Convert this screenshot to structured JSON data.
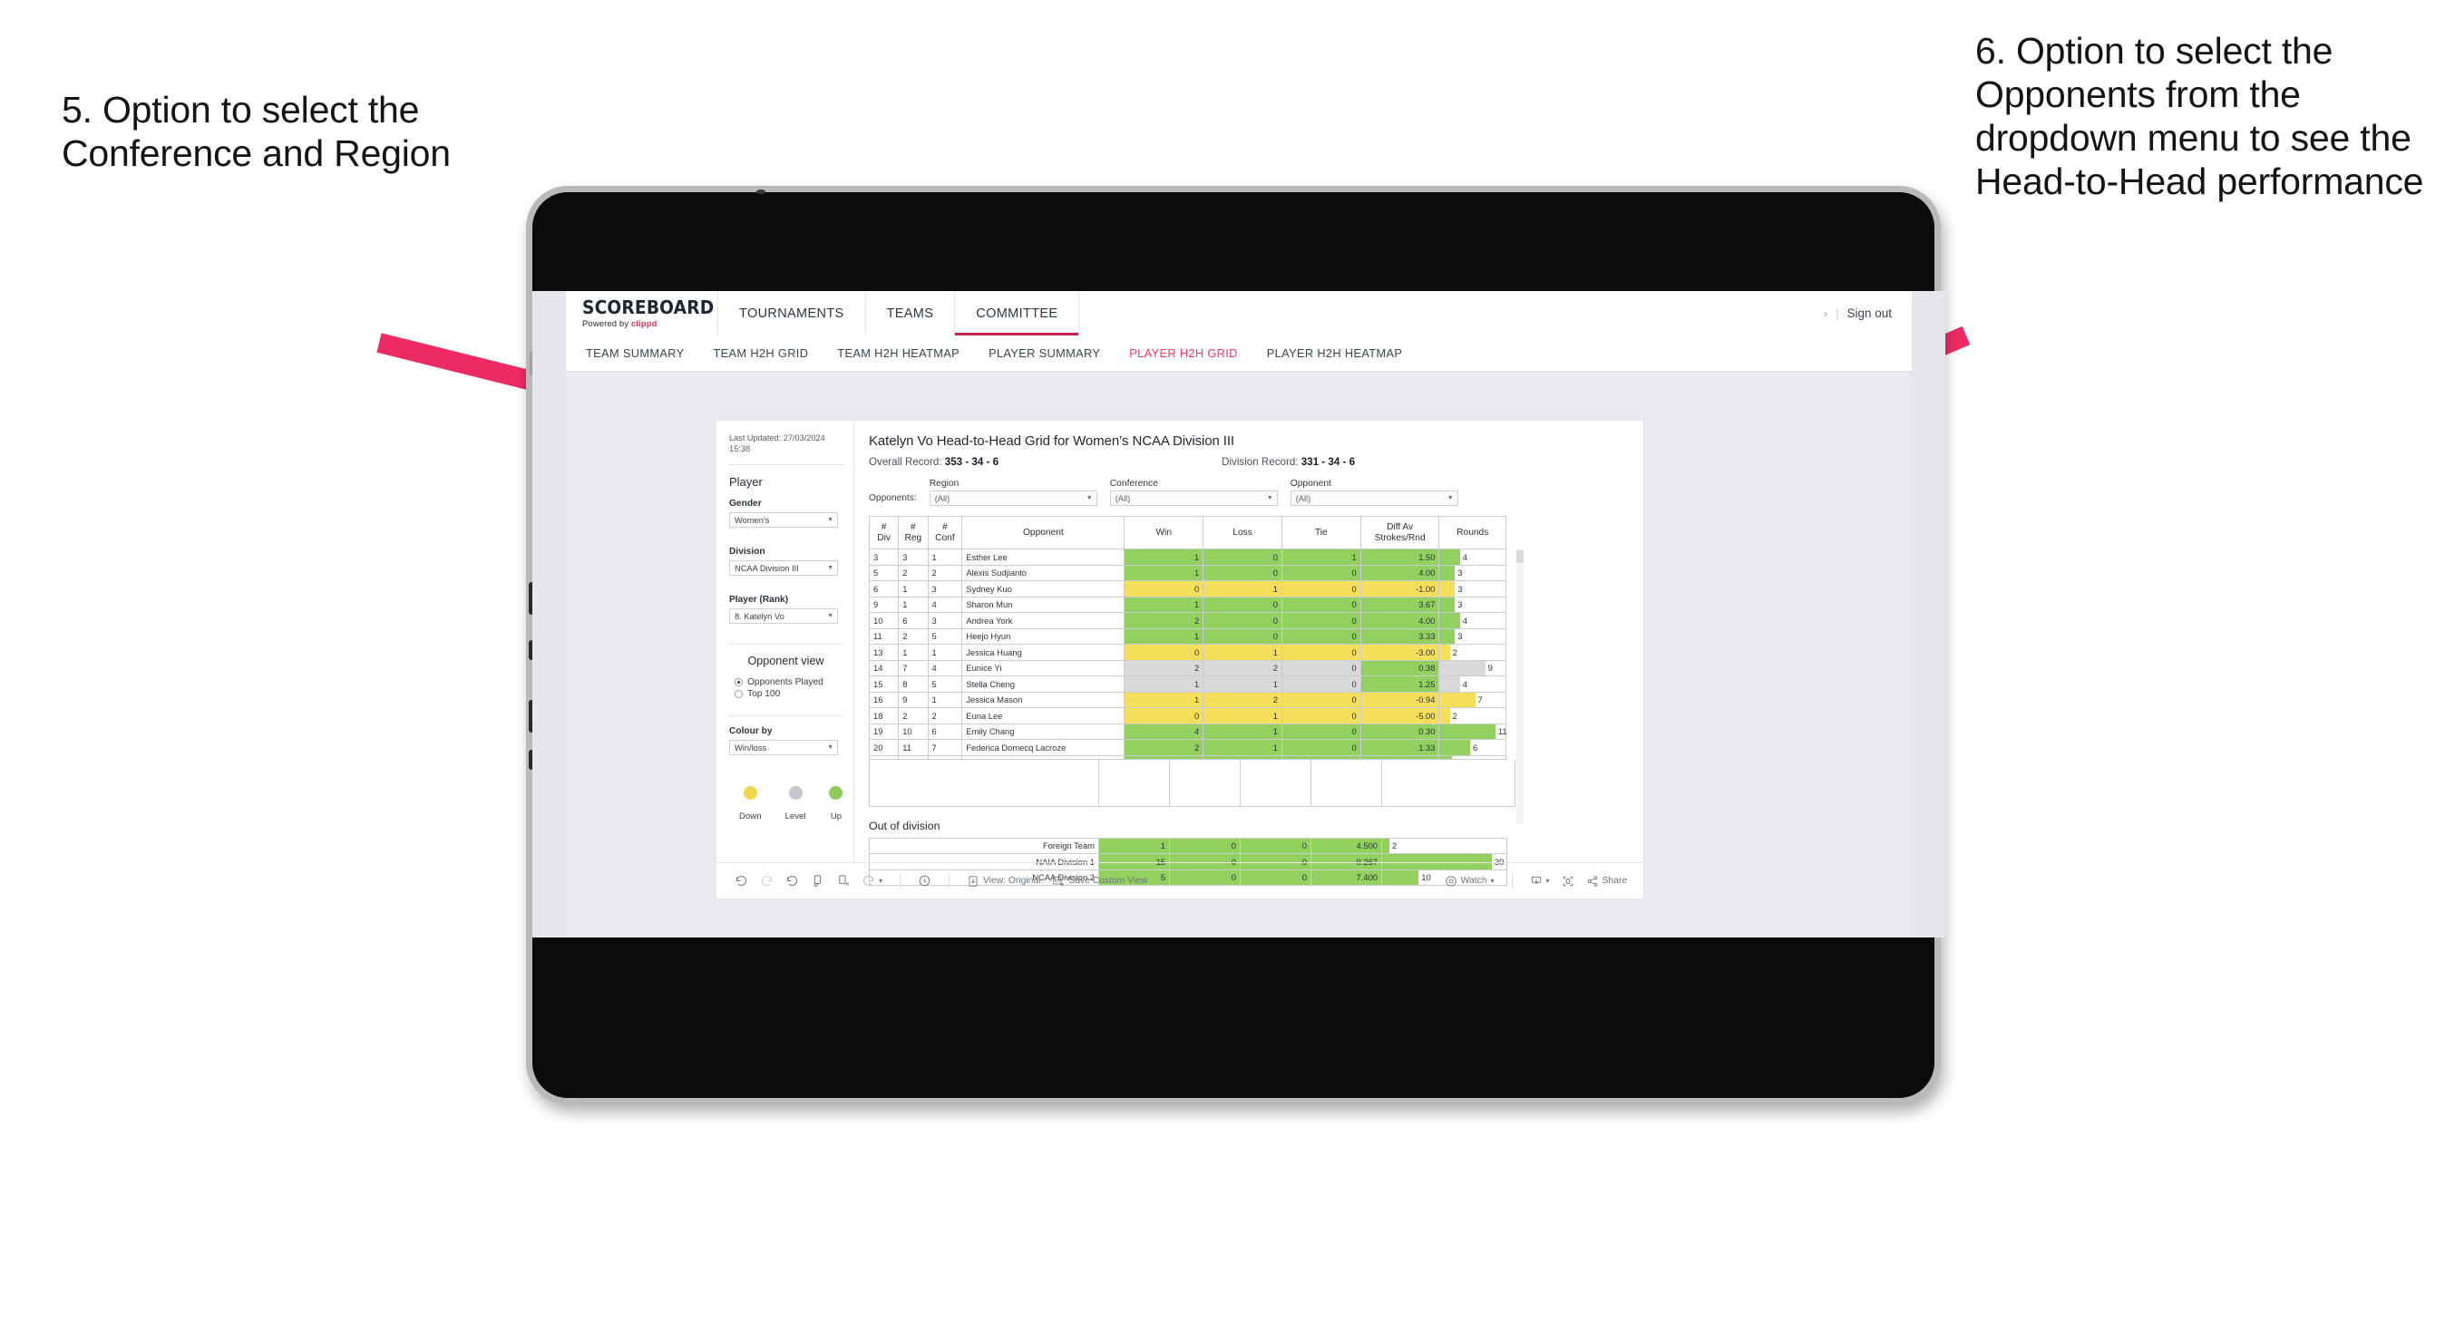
{
  "annotations": {
    "left": "5. Option to select the Conference and Region",
    "right": "6. Option to select the Opponents from the dropdown menu to see the Head-to-Head performance",
    "arrow_color": "#ec2a63"
  },
  "app": {
    "logo_main": "SCOREBOARD",
    "logo_sub_prefix": "Powered by ",
    "logo_sub_brand": "clippd",
    "top_nav": [
      {
        "label": "TOURNAMENTS",
        "active": false
      },
      {
        "label": "TEAMS",
        "active": false
      },
      {
        "label": "COMMITTEE",
        "active": true
      }
    ],
    "sign_out": "Sign out",
    "sign_out_chevron": "›",
    "sign_out_divider": "|",
    "sub_nav": [
      {
        "label": "TEAM SUMMARY",
        "active": false
      },
      {
        "label": "TEAM H2H GRID",
        "active": false
      },
      {
        "label": "TEAM H2H HEATMAP",
        "active": false
      },
      {
        "label": "PLAYER SUMMARY",
        "active": false
      },
      {
        "label": "PLAYER H2H GRID",
        "active": true
      },
      {
        "label": "PLAYER H2H HEATMAP",
        "active": false
      }
    ],
    "accent_color": "#ef3b63"
  },
  "sidebar": {
    "last_updated": "Last Updated: 27/03/2024 15:38",
    "player_heading": "Player",
    "gender_label": "Gender",
    "gender_value": "Women’s",
    "division_label": "Division",
    "division_value": "NCAA Division III",
    "player_rank_label": "Player (Rank)",
    "player_rank_value": "8. Katelyn Vo",
    "opponent_view_heading": "Opponent view",
    "opponent_view_options": [
      {
        "label": "Opponents Played",
        "selected": true
      },
      {
        "label": "Top 100",
        "selected": false
      }
    ],
    "colour_by_label": "Colour by",
    "colour_by_value": "Win/loss",
    "legend": [
      {
        "label": "Down",
        "color": "#f2d64b"
      },
      {
        "label": "Level",
        "color": "#c4c8cc"
      },
      {
        "label": "Up",
        "color": "#8ccb5c"
      }
    ]
  },
  "viz": {
    "title": "Katelyn Vo Head-to-Head Grid for Women’s NCAA Division III",
    "overall_record_label": "Overall Record:",
    "overall_record_value": "353 - 34 - 6",
    "division_record_label": "Division Record:",
    "division_record_value": "331 - 34 - 6",
    "opponents_label": "Opponents:",
    "filters": [
      {
        "title": "Region",
        "value": "(All)"
      },
      {
        "title": "Conference",
        "value": "(All)"
      },
      {
        "title": "Opponent",
        "value": "(All)"
      }
    ],
    "out_of_division_title": "Out of division"
  },
  "chart_data": {
    "type": "table",
    "title": "Katelyn Vo Head-to-Head Grid for Women’s NCAA Division III",
    "columns": [
      "# Div",
      "# Reg",
      "# Conf",
      "Opponent",
      "Win",
      "Loss",
      "Tie",
      "Diff Av Strokes/Rnd",
      "Rounds"
    ],
    "column_headers_two_line": [
      {
        "l1": "#",
        "l2": "Div"
      },
      {
        "l1": "#",
        "l2": "Reg"
      },
      {
        "l1": "#",
        "l2": "Conf"
      },
      {
        "l1": "Opponent",
        "l2": ""
      },
      {
        "l1": "Win",
        "l2": ""
      },
      {
        "l1": "Loss",
        "l2": ""
      },
      {
        "l1": "Tie",
        "l2": ""
      },
      {
        "l1": "Diff Av",
        "l2": "Strokes/Rnd"
      },
      {
        "l1": "Rounds",
        "l2": ""
      }
    ],
    "colour_legend": {
      "up": "#92d05f",
      "down": "#f5de5a",
      "level": "#d9d9d9"
    },
    "rounds_max": 13,
    "rows": [
      {
        "div": "3",
        "reg": "3",
        "conf": "1",
        "opponent": "Esther Lee",
        "win": "1",
        "loss": "0",
        "tie": "1",
        "diff": "1.50",
        "rounds": "4",
        "colour": "up"
      },
      {
        "div": "5",
        "reg": "2",
        "conf": "2",
        "opponent": "Alexis Sudjianto",
        "win": "1",
        "loss": "0",
        "tie": "0",
        "diff": "4.00",
        "rounds": "3",
        "colour": "up"
      },
      {
        "div": "6",
        "reg": "1",
        "conf": "3",
        "opponent": "Sydney Kuo",
        "win": "0",
        "loss": "1",
        "tie": "0",
        "diff": "-1.00",
        "rounds": "3",
        "colour": "down"
      },
      {
        "div": "9",
        "reg": "1",
        "conf": "4",
        "opponent": "Sharon Mun",
        "win": "1",
        "loss": "0",
        "tie": "0",
        "diff": "3.67",
        "rounds": "3",
        "colour": "up"
      },
      {
        "div": "10",
        "reg": "6",
        "conf": "3",
        "opponent": "Andrea York",
        "win": "2",
        "loss": "0",
        "tie": "0",
        "diff": "4.00",
        "rounds": "4",
        "colour": "up"
      },
      {
        "div": "11",
        "reg": "2",
        "conf": "5",
        "opponent": "Heejo Hyun",
        "win": "1",
        "loss": "0",
        "tie": "0",
        "diff": "3.33",
        "rounds": "3",
        "colour": "up"
      },
      {
        "div": "13",
        "reg": "1",
        "conf": "1",
        "opponent": "Jessica Huang",
        "win": "0",
        "loss": "1",
        "tie": "0",
        "diff": "-3.00",
        "rounds": "2",
        "colour": "down"
      },
      {
        "div": "14",
        "reg": "7",
        "conf": "4",
        "opponent": "Eunice Yi",
        "win": "2",
        "loss": "2",
        "tie": "0",
        "diff": "0.38",
        "rounds": "9",
        "colour": "level",
        "diff_colour": "up"
      },
      {
        "div": "15",
        "reg": "8",
        "conf": "5",
        "opponent": "Stella Cheng",
        "win": "1",
        "loss": "1",
        "tie": "0",
        "diff": "1.25",
        "rounds": "4",
        "colour": "level",
        "diff_colour": "up"
      },
      {
        "div": "16",
        "reg": "9",
        "conf": "1",
        "opponent": "Jessica Mason",
        "win": "1",
        "loss": "2",
        "tie": "0",
        "diff": "-0.94",
        "rounds": "7",
        "colour": "down"
      },
      {
        "div": "18",
        "reg": "2",
        "conf": "2",
        "opponent": "Euna Lee",
        "win": "0",
        "loss": "1",
        "tie": "0",
        "diff": "-5.00",
        "rounds": "2",
        "colour": "down"
      },
      {
        "div": "19",
        "reg": "10",
        "conf": "6",
        "opponent": "Emily Chang",
        "win": "4",
        "loss": "1",
        "tie": "0",
        "diff": "0.30",
        "rounds": "11",
        "colour": "up"
      },
      {
        "div": "20",
        "reg": "11",
        "conf": "7",
        "opponent": "Federica Domecq Lacroze",
        "win": "2",
        "loss": "1",
        "tie": "0",
        "diff": "1.33",
        "rounds": "6",
        "colour": "up"
      }
    ],
    "out_of_division": {
      "rounds_max": 34,
      "rows": [
        {
          "label": "Foreign Team",
          "win": "1",
          "loss": "0",
          "tie": "0",
          "diff": "4.500",
          "rounds": "2",
          "colour": "up"
        },
        {
          "label": "NAIA Division 1",
          "win": "15",
          "loss": "0",
          "tie": "0",
          "diff": "9.267",
          "rounds": "30",
          "colour": "up"
        },
        {
          "label": "NCAA Division 2",
          "win": "5",
          "loss": "0",
          "tie": "0",
          "diff": "7.400",
          "rounds": "10",
          "colour": "up"
        }
      ]
    }
  },
  "toolbar": {
    "view_label": "View: Original",
    "save_label": "Save Custom View",
    "watch_label": "Watch",
    "share_label": "Share",
    "caret": "▾"
  }
}
